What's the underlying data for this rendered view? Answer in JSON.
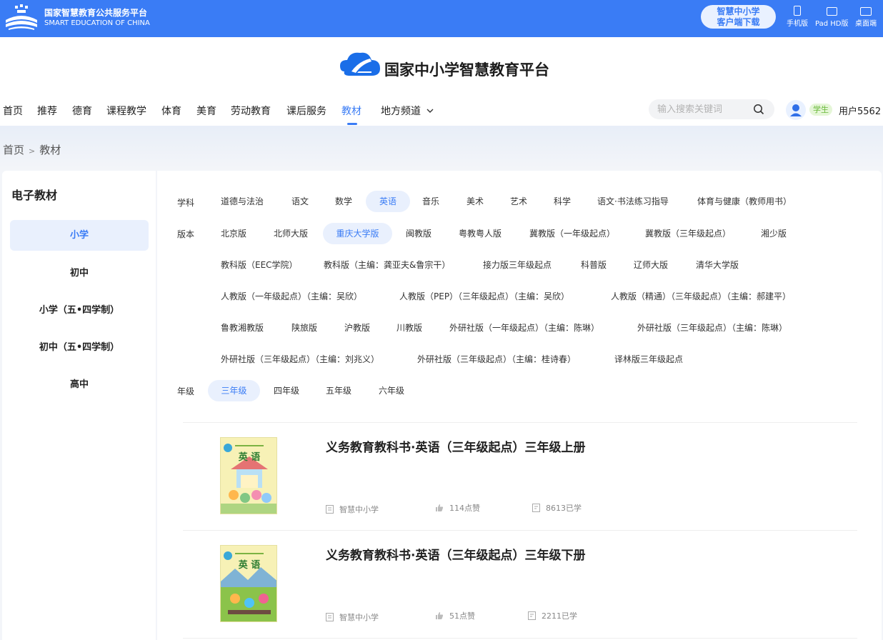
{
  "topbar": {
    "title": "国家智慧教育公共服务平台",
    "subtitle": "SMART EDUCATION OF CHINA",
    "download_line1": "智慧中小学",
    "download_line2": "客户端下载",
    "devices": [
      {
        "label": "手机版",
        "icon": "phone-icon"
      },
      {
        "label": "Pad HD版",
        "icon": "tablet-icon"
      },
      {
        "label": "桌面端",
        "icon": "desktop-icon"
      }
    ],
    "color": "#3a7cf5"
  },
  "site": {
    "name": "国家中小学智慧教育平台"
  },
  "nav": {
    "items": [
      "首页",
      "推荐",
      "德育",
      "课程教学",
      "体育",
      "美育",
      "劳动教育",
      "课后服务",
      "教材",
      "地方频道"
    ],
    "active": "教材",
    "search_placeholder": "输入搜索关键词",
    "role": "学生",
    "username": "用户5562"
  },
  "breadcrumb": {
    "home": "首页",
    "separator": ">",
    "current": "教材"
  },
  "sidebar": {
    "title": "电子教材",
    "items": [
      "小学",
      "初中",
      "小学（五•四学制）",
      "初中（五•四学制）",
      "高中"
    ],
    "active": "小学"
  },
  "filters": {
    "subject_label": "学科",
    "subjects": [
      "道德与法治",
      "语文",
      "数学",
      "英语",
      "音乐",
      "美术",
      "艺术",
      "科学",
      "语文·书法练习指导",
      "体育与健康（教师用书）"
    ],
    "subject_active": "英语",
    "edition_label": "版本",
    "editions": [
      "北京版",
      "北师大版",
      "重庆大学版",
      "闽教版",
      "粤教粤人版",
      "冀教版（一年级起点）",
      "冀教版（三年级起点）",
      "湘少版",
      "教科版（EEC学院）",
      "教科版（主编：龚亚夫&鲁宗干）",
      "接力版三年级起点",
      "科普版",
      "辽师大版",
      "清华大学版",
      "人教版（一年级起点）（主编：吴欣）",
      "人教版（PEP）（三年级起点）（主编：吴欣）",
      "人教版（精通）（三年级起点）（主编：郝建平）",
      "鲁教湘教版",
      "陕旅版",
      "沪教版",
      "川教版",
      "外研社版（一年级起点）（主编：陈琳）",
      "外研社版（三年级起点）（主编：陈琳）",
      "外研社版（三年级起点）（主编：刘兆义）",
      "外研社版（三年级起点）（主编：桂诗春）",
      "译林版三年级起点"
    ],
    "edition_active": "重庆大学版",
    "grade_label": "年级",
    "grades": [
      "三年级",
      "四年级",
      "五年级",
      "六年级"
    ],
    "grade_active": "三年级",
    "accent": "#3a7cf5"
  },
  "books": [
    {
      "title": "义务教育教科书·英语（三年级起点）三年级上册",
      "cover_title": "英 语",
      "publisher": "智慧中小学",
      "likes": "114点赞",
      "learners": "8613已学"
    },
    {
      "title": "义务教育教科书·英语（三年级起点）三年级下册",
      "cover_title": "英 语",
      "publisher": "智慧中小学",
      "likes": "51点赞",
      "learners": "2211已学"
    }
  ]
}
